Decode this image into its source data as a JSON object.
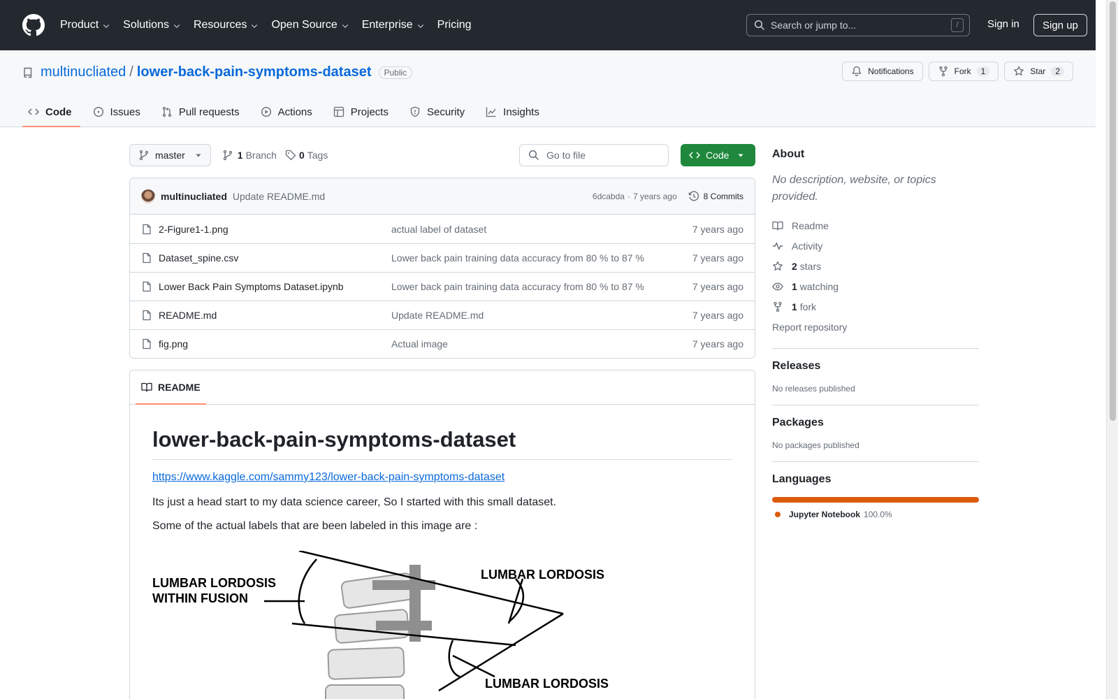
{
  "header": {
    "nav": [
      {
        "label": "Product",
        "has_menu": true
      },
      {
        "label": "Solutions",
        "has_menu": true
      },
      {
        "label": "Resources",
        "has_menu": true
      },
      {
        "label": "Open Source",
        "has_menu": true
      },
      {
        "label": "Enterprise",
        "has_menu": true
      },
      {
        "label": "Pricing",
        "has_menu": false
      }
    ],
    "search_placeholder": "Search or jump to...",
    "search_shortcut": "/",
    "sign_in": "Sign in",
    "sign_up": "Sign up"
  },
  "repo": {
    "owner": "multinucliated",
    "separator": "/",
    "name": "lower-back-pain-symptoms-dataset",
    "visibility": "Public",
    "actions": {
      "notifications": "Notifications",
      "fork_label": "Fork",
      "fork_count": "1",
      "star_label": "Star",
      "star_count": "2"
    },
    "tabs": [
      {
        "label": "Code",
        "icon": "code-icon",
        "active": true
      },
      {
        "label": "Issues",
        "icon": "issue-icon",
        "active": false
      },
      {
        "label": "Pull requests",
        "icon": "pull-request-icon",
        "active": false
      },
      {
        "label": "Actions",
        "icon": "play-icon",
        "active": false
      },
      {
        "label": "Projects",
        "icon": "table-icon",
        "active": false
      },
      {
        "label": "Security",
        "icon": "shield-icon",
        "active": false
      },
      {
        "label": "Insights",
        "icon": "graph-icon",
        "active": false
      }
    ]
  },
  "toolbar": {
    "branch": "master",
    "branch_count": "1",
    "branch_label": "Branch",
    "tag_count": "0",
    "tag_label": "Tags",
    "goto_placeholder": "Go to file",
    "code_button": "Code"
  },
  "latest_commit": {
    "author": "multinucliated",
    "message": "Update README.md",
    "hash": "6dcabda",
    "dot": "·",
    "age": "7 years ago",
    "commits": "8 Commits"
  },
  "files": [
    {
      "name": "2-Figure1-1.png",
      "commit": "actual label of dataset",
      "time": "7 years ago"
    },
    {
      "name": "Dataset_spine.csv",
      "commit": "Lower back pain training data accuracy from 80 % to 87 %",
      "time": "7 years ago"
    },
    {
      "name": "Lower Back Pain Symptoms Dataset.ipynb",
      "commit": "Lower back pain training data accuracy from 80 % to 87 %",
      "time": "7 years ago"
    },
    {
      "name": "README.md",
      "commit": "Update README.md",
      "time": "7 years ago"
    },
    {
      "name": "fig.png",
      "commit": "Actual image",
      "time": "7 years ago"
    }
  ],
  "readme": {
    "tab": "README",
    "title": "lower-back-pain-symptoms-dataset",
    "link": "https://www.kaggle.com/sammy123/lower-back-pain-symptoms-dataset",
    "p1": "Its just a head start to my data science career, So I started with this small dataset.",
    "p2": "Some of the actual labels that are been labeled in this image are :",
    "figure": {
      "label_left_1": "LUMBAR LORDOSIS",
      "label_left_2": "WITHIN FUSION",
      "label_top_right": "LUMBAR LORDOSIS",
      "label_bottom_right": "LUMBAR LORDOSIS"
    }
  },
  "sidebar": {
    "about_title": "About",
    "about_desc": "No description, website, or topics provided.",
    "readme": "Readme",
    "activity": "Activity",
    "stars_count": "2",
    "stars_label": "stars",
    "watching_count": "1",
    "watching_label": "watching",
    "fork_count": "1",
    "fork_label": "fork",
    "report": "Report repository",
    "releases_title": "Releases",
    "releases_text": "No releases published",
    "packages_title": "Packages",
    "packages_text": "No packages published",
    "languages_title": "Languages",
    "language_name": "Jupyter Notebook",
    "language_pct": "100.0%",
    "language_color": "#da5b0b"
  }
}
